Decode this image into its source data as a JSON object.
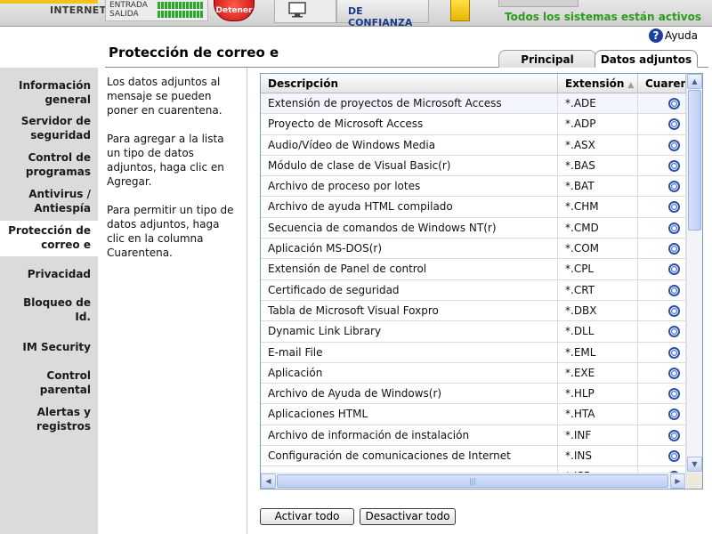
{
  "topbar": {
    "internet_label": "INTERNET",
    "traffic_in_label": "ENTRADA",
    "traffic_out_label": "SALIDA",
    "stop_label": "Detener",
    "zone_label": "DE CONFIANZA",
    "status_text": "Todos los sistemas están activos"
  },
  "help": {
    "label": "Ayuda",
    "icon": "question-icon"
  },
  "page": {
    "title": "Protección de correo e"
  },
  "tabs": [
    {
      "label": "Principal",
      "active": false
    },
    {
      "label": "Datos adjuntos",
      "active": true
    }
  ],
  "sidebar": {
    "items": [
      {
        "label1": "Información",
        "label2": "general"
      },
      {
        "label1": "Servidor de",
        "label2": "seguridad"
      },
      {
        "label1": "Control de",
        "label2": "programas"
      },
      {
        "label1": "Antivirus /",
        "label2": "Antiespía"
      },
      {
        "label1": "Protección de",
        "label2": "correo e",
        "active": true
      },
      {
        "label1": "Privacidad",
        "label2": ""
      },
      {
        "label1": "Bloqueo de",
        "label2": "Id."
      },
      {
        "label1": "IM Security",
        "label2": ""
      },
      {
        "label1": "Control",
        "label2": "parental"
      },
      {
        "label1": "Alertas y",
        "label2": "registros"
      }
    ]
  },
  "description": {
    "p1": "Los datos adjuntos al mensaje se pueden poner en cuarentena.",
    "p2": "Para agregar a la lista un tipo de datos adjuntos, haga clic en Agregar.",
    "p3": "Para permitir un tipo de datos adjuntos, haga clic en la columna Cuarentena."
  },
  "table": {
    "headers": {
      "description": "Descripción",
      "extension": "Extensión",
      "quarantine": "Cuarentena"
    },
    "rows": [
      {
        "description": "Extensión de proyectos de Microsoft Access",
        "extension": "*.ADE"
      },
      {
        "description": "Proyecto de Microsoft Access",
        "extension": "*.ADP"
      },
      {
        "description": "Audio/Vídeo de Windows Media",
        "extension": "*.ASX"
      },
      {
        "description": "Módulo de clase de Visual Basic(r)",
        "extension": "*.BAS"
      },
      {
        "description": "Archivo de proceso por lotes",
        "extension": "*.BAT"
      },
      {
        "description": "Archivo de ayuda HTML compilado",
        "extension": "*.CHM"
      },
      {
        "description": "Secuencia de comandos de Windows NT(r)",
        "extension": "*.CMD"
      },
      {
        "description": "Aplicación MS-DOS(r)",
        "extension": "*.COM"
      },
      {
        "description": "Extensión de Panel de control",
        "extension": "*.CPL"
      },
      {
        "description": "Certificado de seguridad",
        "extension": "*.CRT"
      },
      {
        "description": "Tabla de Microsoft Visual Foxpro",
        "extension": "*.DBX"
      },
      {
        "description": "Dynamic Link Library",
        "extension": "*.DLL"
      },
      {
        "description": "E-mail File",
        "extension": "*.EML"
      },
      {
        "description": "Aplicación",
        "extension": "*.EXE"
      },
      {
        "description": "Archivo de Ayuda de Windows(r)",
        "extension": "*.HLP"
      },
      {
        "description": "Aplicaciones HTML",
        "extension": "*.HTA"
      },
      {
        "description": "Archivo de información de instalación",
        "extension": "*.INF"
      },
      {
        "description": "Configuración de comunicaciones de Internet",
        "extension": "*.INS"
      },
      {
        "description": "",
        "extension": "*.ISP"
      }
    ]
  },
  "buttons": {
    "activate_all": "Activar todo",
    "deactivate_all": "Desactivar todo"
  },
  "colors": {
    "status": "#2c9a1c",
    "accent": "#f2c318",
    "stop": "#d81818",
    "help": "#1d3f9e"
  }
}
